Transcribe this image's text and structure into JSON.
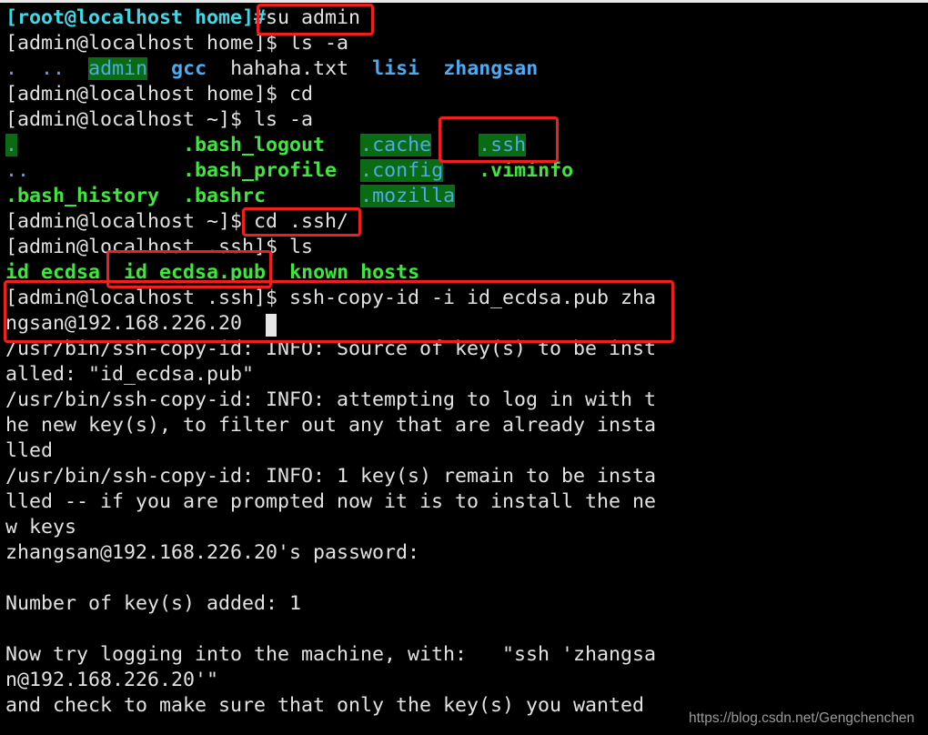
{
  "colors": {
    "text": "#e2e2e2",
    "root_prompt": "#3fd8e6",
    "dir": "#4aaaf2",
    "exec": "#3ee63e",
    "highlight_bg": "#0b6b12",
    "annotation": "#f01e1e"
  },
  "terminal": {
    "lines": [
      [
        {
          "t": "[root@localhost home]#",
          "c": "root_prompt",
          "b": true
        },
        {
          "t": "su admin"
        }
      ],
      [
        {
          "t": "[admin@localhost home]$ ls -a"
        }
      ],
      [
        {
          "t": ".",
          "c": "dir"
        },
        {
          "t": "  "
        },
        {
          "t": "..",
          "c": "dir"
        },
        {
          "t": "  "
        },
        {
          "t": "admin",
          "c": "dir",
          "bg": true
        },
        {
          "t": "  "
        },
        {
          "t": "gcc",
          "c": "dir",
          "b": true
        },
        {
          "t": "  "
        },
        {
          "t": "hahaha.txt"
        },
        {
          "t": "  "
        },
        {
          "t": "lisi",
          "c": "dir",
          "b": true
        },
        {
          "t": "  "
        },
        {
          "t": "zhangsan",
          "c": "dir",
          "b": true
        }
      ],
      [
        {
          "t": "[admin@localhost home]$ cd"
        }
      ],
      [
        {
          "t": "[admin@localhost ~]$ ls -a"
        }
      ],
      [
        {
          "t": ".",
          "c": "dir",
          "bg": true
        },
        {
          "t": "              "
        },
        {
          "t": ".bash_logout",
          "c": "exec",
          "b": true
        },
        {
          "t": "   "
        },
        {
          "t": ".cache",
          "c": "dir",
          "bg": true
        },
        {
          "t": "    "
        },
        {
          "t": ".ssh",
          "c": "dir",
          "bg": true
        }
      ],
      [
        {
          "t": "..",
          "c": "dir"
        },
        {
          "t": "             "
        },
        {
          "t": ".bash_profile",
          "c": "exec",
          "b": true
        },
        {
          "t": "  "
        },
        {
          "t": ".config",
          "c": "dir",
          "bg": true
        },
        {
          "t": "   "
        },
        {
          "t": ".viminfo",
          "c": "exec",
          "b": true
        }
      ],
      [
        {
          "t": ".bash_history",
          "c": "exec",
          "b": true
        },
        {
          "t": "  "
        },
        {
          "t": ".bashrc",
          "c": "exec",
          "b": true
        },
        {
          "t": "        "
        },
        {
          "t": ".mozilla",
          "c": "dir",
          "bg": true
        }
      ],
      [
        {
          "t": "[admin@localhost ~]$ cd .ssh/"
        }
      ],
      [
        {
          "t": "[admin@localhost .ssh]$ ls"
        }
      ],
      [
        {
          "t": "id_ecdsa",
          "c": "exec",
          "b": true
        },
        {
          "t": "  "
        },
        {
          "t": "id_ecdsa.pub",
          "c": "exec",
          "b": true
        },
        {
          "t": "  "
        },
        {
          "t": "known_hosts",
          "c": "exec",
          "b": true
        }
      ],
      [
        {
          "t": "[admin@localhost .ssh]$ ssh-copy-id -i id_ecdsa.pub zha"
        }
      ],
      [
        {
          "t": "ngsan@192.168.226.20"
        }
      ],
      [
        {
          "t": "/usr/bin/ssh-copy-id: INFO: Source of key(s) to be inst"
        }
      ],
      [
        {
          "t": "alled: \"id_ecdsa.pub\""
        }
      ],
      [
        {
          "t": "/usr/bin/ssh-copy-id: INFO: attempting to log in with t"
        }
      ],
      [
        {
          "t": "he new key(s), to filter out any that are already insta"
        }
      ],
      [
        {
          "t": "lled"
        }
      ],
      [
        {
          "t": "/usr/bin/ssh-copy-id: INFO: 1 key(s) remain to be insta"
        }
      ],
      [
        {
          "t": "lled -- if you are prompted now it is to install the ne"
        }
      ],
      [
        {
          "t": "w keys"
        }
      ],
      [
        {
          "t": "zhangsan@192.168.226.20's password:"
        }
      ],
      [],
      [
        {
          "t": "Number of key(s) added: 1"
        }
      ],
      [],
      [
        {
          "t": "Now try logging into the machine, with:   \"ssh 'zhangsa"
        }
      ],
      [
        {
          "t": "n@192.168.226.20'\""
        }
      ],
      [
        {
          "t": "and check to make sure that only the key(s) you wanted"
        }
      ]
    ]
  },
  "watermark": "https://blog.csdn.net/Gengchenchen"
}
